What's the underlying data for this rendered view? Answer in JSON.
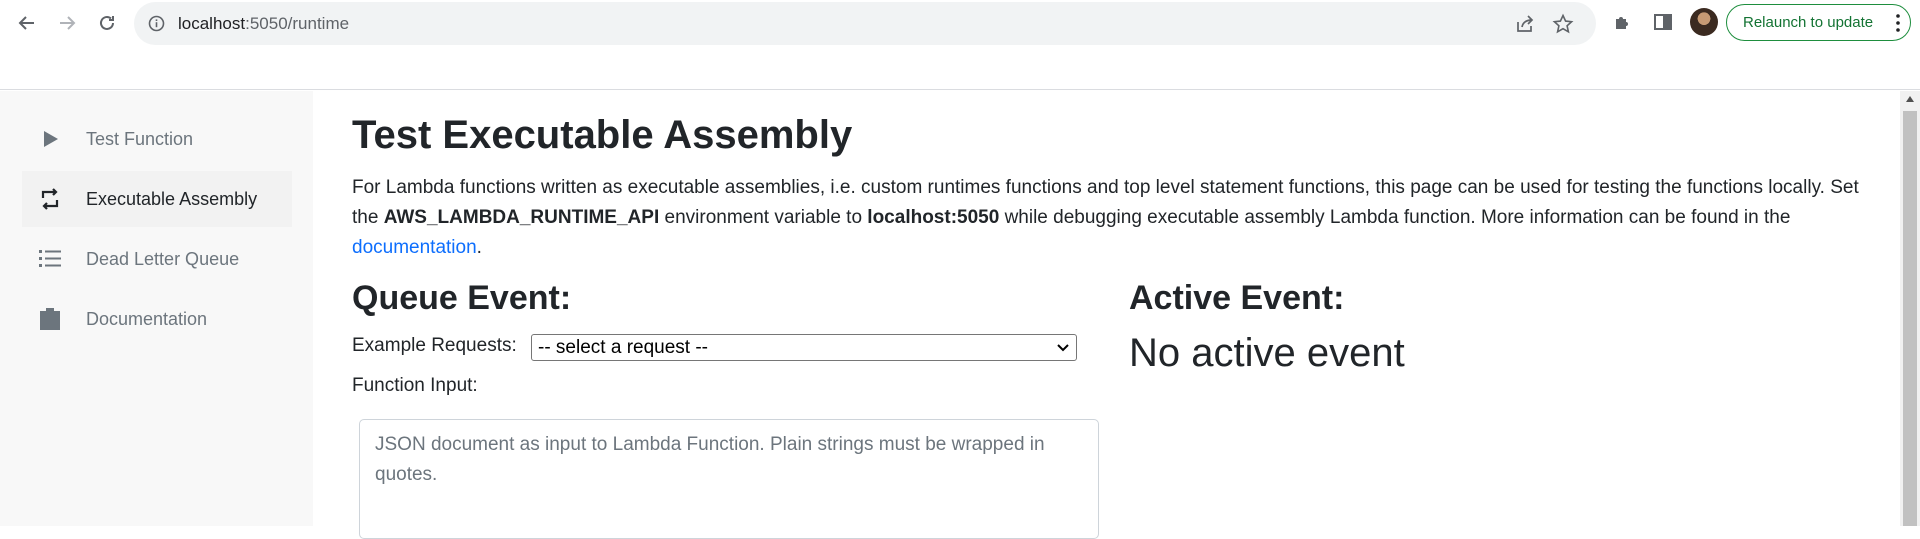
{
  "browser": {
    "url_host": "localhost",
    "url_path": ":5050/runtime",
    "relaunch_label": "Relaunch to update"
  },
  "sidebar": {
    "items": [
      {
        "label": "Test Function",
        "icon": "play-icon",
        "active": false
      },
      {
        "label": "Executable Assembly",
        "icon": "repeat-icon",
        "active": true
      },
      {
        "label": "Dead Letter Queue",
        "icon": "list-icon",
        "active": false
      },
      {
        "label": "Documentation",
        "icon": "clipboard-icon",
        "active": false
      }
    ]
  },
  "main": {
    "title": "Test Executable Assembly",
    "intro": {
      "part1": "For Lambda functions written as executable assemblies, i.e. custom runtimes functions and top level statement functions, this page can be used for testing the functions locally. Set the ",
      "env_var": "AWS_LAMBDA_RUNTIME_API",
      "part2": " environment variable to ",
      "host": "localhost:5050",
      "part3": " while debugging executable assembly Lambda function. More information can be found in the ",
      "link": "documentation",
      "part4": "."
    },
    "queue": {
      "title": "Queue Event:",
      "example_label": "Example Requests:",
      "select_value": "-- select a request --",
      "input_label": "Function Input:",
      "input_placeholder": "JSON document as input to Lambda Function. Plain strings must be wrapped in quotes."
    },
    "active": {
      "title": "Active Event:",
      "status": "No active event"
    }
  },
  "colors": {
    "link": "#0d6efd",
    "relaunch": "#137333",
    "sidebar_bg": "#f8f8f8"
  }
}
